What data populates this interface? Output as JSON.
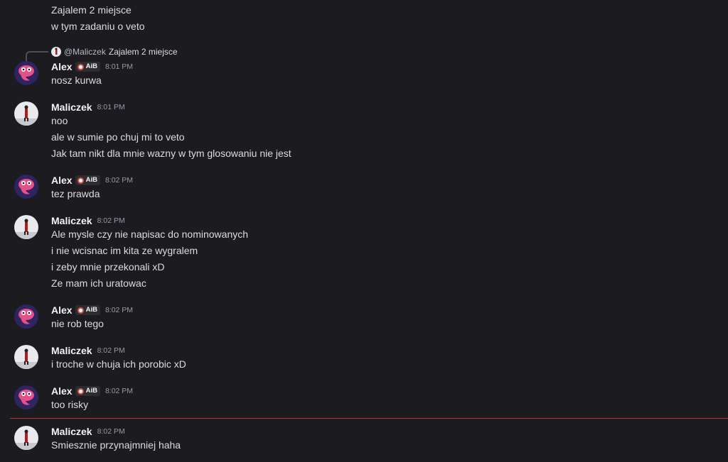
{
  "top_lines": [
    "Zajalem 2 miejsce",
    "w tym zadaniu o veto"
  ],
  "reply": {
    "mention": "@Maliczek",
    "text": "Zajalem 2 miejsce"
  },
  "messages": [
    {
      "author": "Alex",
      "tag": "AiB",
      "time": "8:01 PM",
      "lines": [
        "nosz kurwa"
      ]
    },
    {
      "author": "Maliczek",
      "time": "8:01 PM",
      "lines": [
        "noo",
        "ale w sumie po chuj mi to veto",
        "Jak tam nikt dla mnie wazny w tym glosowaniu nie jest"
      ]
    },
    {
      "author": "Alex",
      "tag": "AiB",
      "time": "8:02 PM",
      "lines": [
        "tez prawda"
      ]
    },
    {
      "author": "Maliczek",
      "time": "8:02 PM",
      "lines": [
        "Ale mysle czy nie napisac do nominowanych",
        "i nie wcisnac im kita ze wygralem",
        "i zeby mnie przekonali xD",
        "Ze mam ich uratowac"
      ]
    },
    {
      "author": "Alex",
      "tag": "AiB",
      "time": "8:02 PM",
      "lines": [
        "nie rob tego"
      ]
    },
    {
      "author": "Maliczek",
      "time": "8:02 PM",
      "lines": [
        "i troche w chuja ich porobic xD"
      ]
    },
    {
      "author": "Alex",
      "tag": "AiB",
      "time": "8:02 PM",
      "lines": [
        "too risky"
      ]
    },
    {
      "author": "Maliczek",
      "time": "8:02 PM",
      "lines": [
        "Smiesznie przynajmniej haha"
      ]
    }
  ],
  "colors": {
    "background": "#1b1b20",
    "new_message_divider": "#b8323a",
    "timestamp": "#949ba4"
  }
}
